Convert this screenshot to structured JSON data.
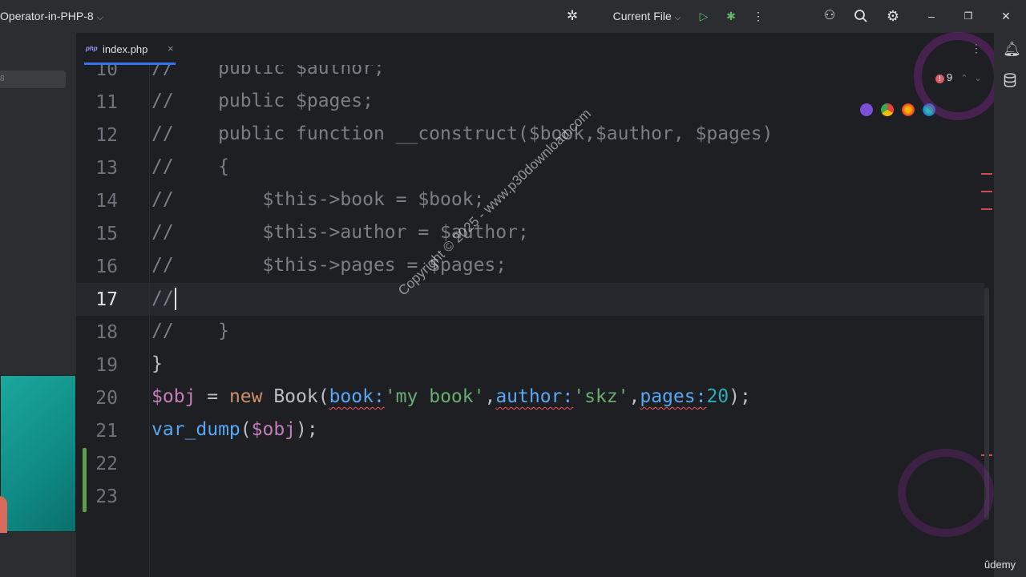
{
  "titlebar": {
    "project": "Operator-in-PHP-8",
    "run_config": "Current File",
    "icons": [
      "bug-settings-icon",
      "run-icon",
      "debug-icon",
      "more-vert-icon",
      "add-user-icon",
      "search-icon",
      "settings-icon",
      "minimize-icon",
      "restore-icon",
      "close-icon"
    ]
  },
  "leftpanel": {
    "filter_text": "8"
  },
  "tab": {
    "icon": "php",
    "name": "index.php",
    "close": "×"
  },
  "editor": {
    "error_count": "9",
    "lines": [
      {
        "n": "10",
        "tokens": [
          [
            "comment",
            "//    "
          ],
          [
            "comment",
            "public $author;"
          ]
        ]
      },
      {
        "n": "11",
        "tokens": [
          [
            "comment",
            "//    public $pages;"
          ]
        ]
      },
      {
        "n": "12",
        "tokens": [
          [
            "comment",
            "//    public function __construct($book,$author, $pages)"
          ]
        ]
      },
      {
        "n": "13",
        "tokens": [
          [
            "comment",
            "//    {"
          ]
        ]
      },
      {
        "n": "14",
        "tokens": [
          [
            "comment",
            "//        $this->book = $book;"
          ]
        ]
      },
      {
        "n": "15",
        "tokens": [
          [
            "comment",
            "//        $this->author = $author;"
          ]
        ]
      },
      {
        "n": "16",
        "tokens": [
          [
            "comment",
            "//        $this->pages = $pages;"
          ]
        ]
      },
      {
        "n": "17",
        "tokens": [
          [
            "comment",
            "//"
          ]
        ],
        "active": true
      },
      {
        "n": "18",
        "tokens": [
          [
            "comment",
            "//    }"
          ]
        ]
      },
      {
        "n": "19",
        "tokens": [
          [
            "plain",
            "}"
          ]
        ]
      },
      {
        "n": "20",
        "tokens": [
          [
            "var",
            "$obj"
          ],
          [
            "plain",
            " = "
          ],
          [
            "kw",
            "new"
          ],
          [
            "plain",
            " Book("
          ],
          [
            "hint",
            "book:"
          ],
          [
            "str",
            "'my book'"
          ],
          [
            "plain",
            ","
          ],
          [
            "hint",
            "author:"
          ],
          [
            "str",
            "'skz'"
          ],
          [
            "plain",
            ","
          ],
          [
            "hint",
            "pages:"
          ],
          [
            "num",
            "20"
          ],
          [
            "plain",
            ");"
          ]
        ]
      },
      {
        "n": "21",
        "tokens": [
          [
            "fn",
            "var_dump"
          ],
          [
            "plain",
            "("
          ],
          [
            "var",
            "$obj"
          ],
          [
            "plain",
            ");"
          ]
        ]
      },
      {
        "n": "22",
        "tokens": []
      },
      {
        "n": "23",
        "tokens": []
      }
    ]
  },
  "watermark": "Copyright © 2025 - www.p30download.com",
  "branding": "ûdemy",
  "colors": {
    "background": "#1e1f22",
    "panel": "#2b2d30",
    "accent": "#3574f0",
    "error": "#e55765"
  }
}
